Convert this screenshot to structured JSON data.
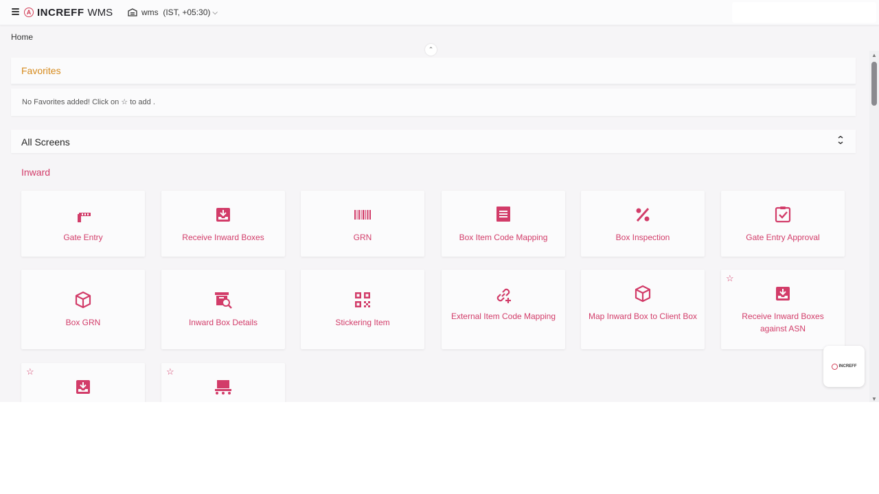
{
  "header": {
    "brand": "INCREFF",
    "product": "WMS",
    "logo_letter": "A",
    "warehouse": "wms",
    "timezone": "(IST, +05:30)"
  },
  "breadcrumb": "Home",
  "favorites": {
    "title": "Favorites",
    "empty_message": "No Favorites added! Click on ☆ to add ."
  },
  "all_screens": {
    "title": "All Screens",
    "toggle_icon": "collapse-icon"
  },
  "inward": {
    "title": "Inward",
    "tiles": [
      {
        "label": "Gate Entry",
        "icon": "gate-barrier-icon"
      },
      {
        "label": "Receive Inward Boxes",
        "icon": "inbox-download-icon"
      },
      {
        "label": "GRN",
        "icon": "barcode-icon"
      },
      {
        "label": "Box Item Code Mapping",
        "icon": "receipt-list-icon"
      },
      {
        "label": "Box Inspection",
        "icon": "percent-icon"
      },
      {
        "label": "Gate Entry Approval",
        "icon": "clipboard-check-icon"
      },
      {
        "label": "Box GRN",
        "icon": "cube-icon"
      },
      {
        "label": "Inward Box Details",
        "icon": "box-search-icon"
      },
      {
        "label": "Stickering Item",
        "icon": "qr-code-icon"
      },
      {
        "label": "External Item Code Mapping",
        "icon": "link-add-icon"
      },
      {
        "label": "Map Inward Box to Client Box",
        "icon": "cube-icon"
      },
      {
        "label": "Receive Inward Boxes against ASN",
        "icon": "inbox-download-icon"
      },
      {
        "label": "",
        "icon": "inbox-download-icon"
      },
      {
        "label": "",
        "icon": "conveyor-icon"
      }
    ]
  },
  "chat_widget": {
    "label": "INCREFF"
  },
  "colors": {
    "accent": "#d23c69",
    "favorites_title": "#d68a1c",
    "background": "#f6f5f7"
  }
}
